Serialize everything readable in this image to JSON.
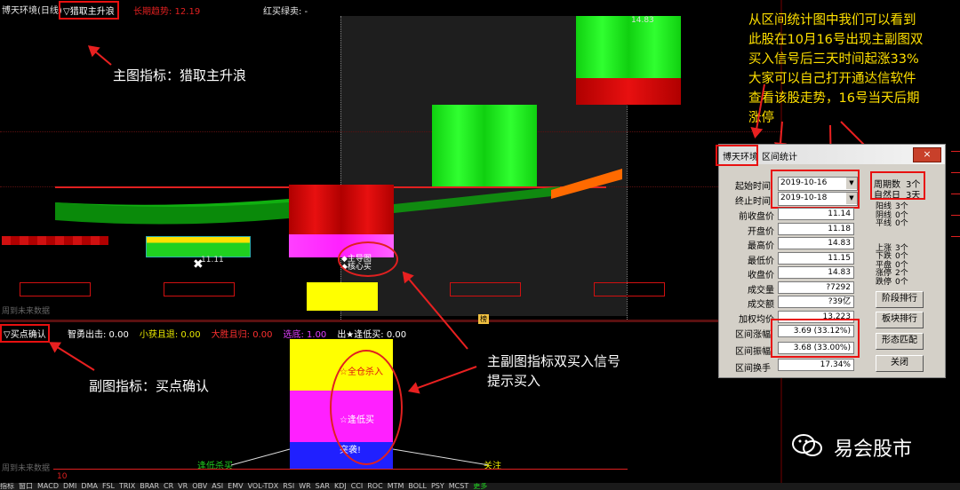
{
  "main_panel": {
    "title": "博天环境(日线)",
    "indicator_name": "▽猎取主升浪",
    "trend_label": "长期趋势: 12.19",
    "signal_label": "红买绿卖: -",
    "price_high_tag": "14.83",
    "price_low_tag": "11.11",
    "buy_tag_1": "◆主导图",
    "buy_tag_2": "◆核心买",
    "future_note": "周到未来数据",
    "bottom_marker": "榜"
  },
  "sub_panel": {
    "indicator_name": "▽买点确认",
    "values": [
      {
        "label": "智勇出击: 0.00",
        "color": "#ffffff"
      },
      {
        "label": "小获且退: 0.00",
        "color": "#e8e800"
      },
      {
        "label": "大胜且归: 0.00",
        "color": "#ff3030"
      },
      {
        "label": "选底: 1.00",
        "color": "#e040ff"
      },
      {
        "label": "出★逢低买: 0.00",
        "color": "#ffffff"
      }
    ],
    "bar_text_top": "☆全仓杀入",
    "bar_text_mid": "☆逢低买",
    "bar_text_bot": "突袭!",
    "low_left_label": "逢低杀买",
    "low_right_label": "关注",
    "future_note": "周到未来数据",
    "axis_label": "10"
  },
  "annotations": {
    "main_indicator": "主图指标：猎取主升浪",
    "sub_indicator": "副图指标：买点确认",
    "double_signal_line1": "主副图指标双买入信号",
    "double_signal_line2": "提示买入",
    "top_right": [
      "从区间统计图中我们可以看到",
      "此股在10月16号出现主副图双",
      "买入信号后三天时间起涨33%",
      "大家可以自己打开通达信软件",
      "查看该股走势，16号当天后期",
      "涨停"
    ]
  },
  "dialog": {
    "title_stock": "博天环境",
    "title_text": "区间统计",
    "close_label": "×",
    "start_label": "起始时间",
    "start_value": "2019-10-16",
    "end_label": "终止时间",
    "end_value": "2019-10-18",
    "period_label": "周期数",
    "period_value": "3个",
    "natural_label": "自然日",
    "natural_value": "3天",
    "fields": [
      {
        "label": "前收盘价",
        "value": "11.14"
      },
      {
        "label": "开盘价",
        "value": "11.18"
      },
      {
        "label": "最高价",
        "value": "14.83"
      },
      {
        "label": "最低价",
        "value": "11.15"
      },
      {
        "label": "收盘价",
        "value": "14.83"
      },
      {
        "label": "成交量",
        "value": "?7292"
      },
      {
        "label": "成交额",
        "value": "?39亿"
      },
      {
        "label": "加权均价",
        "value": "13.223"
      }
    ],
    "range_change_label": "区间涨幅",
    "range_change_value": "3.69 (33.12%)",
    "range_amp_label": "区间振幅",
    "range_amp_value": "3.68 (33.00%)",
    "range_turnover_label": "区间换手",
    "range_turnover_value": "17.34%",
    "stats": [
      {
        "label": "阳线",
        "value": "3个"
      },
      {
        "label": "阴线",
        "value": "0个"
      },
      {
        "label": "平线",
        "value": "0个"
      },
      {
        "label": "上涨",
        "value": "3个"
      },
      {
        "label": "下跌",
        "value": "0个"
      },
      {
        "label": "平盘",
        "value": "0个"
      },
      {
        "label": "涨停",
        "value": "2个"
      },
      {
        "label": "跌停",
        "value": "0个"
      }
    ],
    "buttons": [
      "阶段排行",
      "板块排行",
      "形态匹配",
      "关闭"
    ]
  },
  "watermark": {
    "text": "易会股市"
  },
  "tabs": [
    "指标",
    "窗口",
    "MACD",
    "DMI",
    "DMA",
    "FSL",
    "TRIX",
    "BRAR",
    "CR",
    "VR",
    "OBV",
    "ASI",
    "EMV",
    "VOL-TDX",
    "RSI",
    "WR",
    "SAR",
    "KDJ",
    "CCI",
    "ROC",
    "MTM",
    "BOLL",
    "PSY",
    "MCST",
    "更多"
  ]
}
